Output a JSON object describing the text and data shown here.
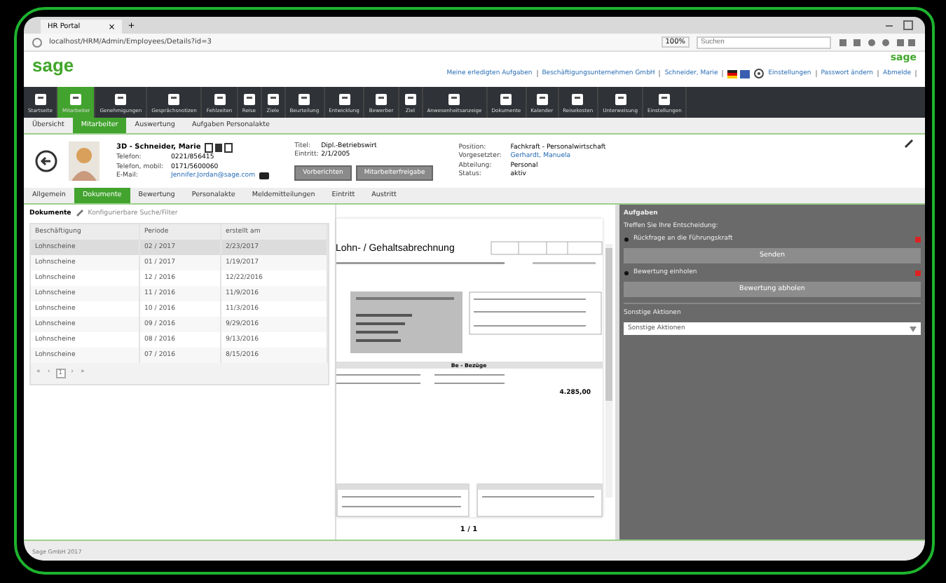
{
  "browser": {
    "tab_title": "HR Portal",
    "tab_close": "×",
    "new_tab": "+",
    "url": "localhost/HRM/Admin/Employees/Details?id=3",
    "zoom": "100%",
    "search_placeholder": "Suchen"
  },
  "header": {
    "logo": "sage",
    "small_logo": "sage",
    "links": [
      "Meine erledigten Aufgaben",
      "Beschäftigungsunternehmen GmbH",
      "Schneider, Marie",
      "Einstellungen",
      "Passwort ändern",
      "Abmelde"
    ]
  },
  "nav": [
    {
      "label": "Startseite",
      "selected": false
    },
    {
      "label": "Mitarbeiter",
      "selected": true
    },
    {
      "label": "Genehmigungen",
      "selected": false
    },
    {
      "label": "Gesprächsnotizen",
      "selected": false
    },
    {
      "label": "Fehlzeiten",
      "selected": false
    },
    {
      "label": "Reise",
      "selected": false
    },
    {
      "label": "Ziele",
      "selected": false
    },
    {
      "label": "Beurteilung",
      "selected": false
    },
    {
      "label": "Entwicklung",
      "selected": false
    },
    {
      "label": "Bewerber",
      "selected": false
    },
    {
      "label": "Ziel",
      "selected": false
    },
    {
      "label": "Anwesenheitsanzeige",
      "selected": false
    },
    {
      "label": "Dokumente",
      "selected": false
    },
    {
      "label": "Kalender",
      "selected": false
    },
    {
      "label": "Reisekosten",
      "selected": false
    },
    {
      "label": "Unterweisung",
      "selected": false
    },
    {
      "label": "Einstellungen",
      "selected": false
    }
  ],
  "subtabs": [
    {
      "label": "Übersicht",
      "selected": false
    },
    {
      "label": "Mitarbeiter",
      "selected": true
    },
    {
      "label": "Auswertung",
      "selected": false
    },
    {
      "label": "Aufgaben Personalakte",
      "selected": false
    }
  ],
  "employee": {
    "name": "3D - Schneider, Marie",
    "left_fields": [
      {
        "label": "Telefon:",
        "value": "0221/856415"
      },
      {
        "label": "Telefon, mobil:",
        "value": "0171/5600060"
      },
      {
        "label": "E-Mail:",
        "value": "Jennifer.Jordan@sage.com",
        "link": true
      }
    ],
    "middle_fields": [
      {
        "label": "Titel:",
        "value": "Dipl.-Betriebswirt"
      },
      {
        "label": "Eintritt:",
        "value": "2/1/2005"
      }
    ],
    "buttons": [
      "Vorberichten",
      "Mitarbeiterfreigabe"
    ],
    "right_fields": [
      {
        "label": "Position:",
        "value": "Fachkraft - Personalwirtschaft",
        "link": false
      },
      {
        "label": "Vorgesetzter:",
        "value": "Gerhardt, Manuela",
        "link": true
      },
      {
        "label": "Abteilung:",
        "value": "Personal",
        "link": false
      },
      {
        "label": "Status:",
        "value": "aktiv",
        "link": false
      }
    ]
  },
  "tabs": [
    {
      "label": "Allgemein",
      "selected": false
    },
    {
      "label": "Dokumente",
      "selected": true
    },
    {
      "label": "Bewertung",
      "selected": false
    },
    {
      "label": "Personalakte",
      "selected": false
    },
    {
      "label": "Meldemitteilungen",
      "selected": false
    },
    {
      "label": "Eintritt",
      "selected": false
    },
    {
      "label": "Austritt",
      "selected": false
    }
  ],
  "documents": {
    "title": "Dokumente",
    "filter": "Konfigurierbare Suche/Filter",
    "columns": [
      "Beschäftigung",
      "Periode",
      "erstellt am"
    ],
    "rows": [
      {
        "cells": [
          "Lohnscheine",
          "02 / 2017",
          "2/23/2017"
        ],
        "selected": true
      },
      {
        "cells": [
          "Lohnscheine",
          "01 / 2017",
          "1/19/2017"
        ],
        "selected": false
      },
      {
        "cells": [
          "Lohnscheine",
          "12 / 2016",
          "12/22/2016"
        ],
        "selected": false
      },
      {
        "cells": [
          "Lohnscheine",
          "11 / 2016",
          "11/9/2016"
        ],
        "selected": false
      },
      {
        "cells": [
          "Lohnscheine",
          "10 / 2016",
          "11/3/2016"
        ],
        "selected": false
      },
      {
        "cells": [
          "Lohnscheine",
          "09 / 2016",
          "9/29/2016"
        ],
        "selected": false
      },
      {
        "cells": [
          "Lohnscheine",
          "08 / 2016",
          "9/13/2016"
        ],
        "selected": false
      },
      {
        "cells": [
          "Lohnscheine",
          "07 / 2016",
          "8/15/2016"
        ],
        "selected": false
      }
    ],
    "pager": [
      {
        "label": "«",
        "selected": false
      },
      {
        "label": "‹",
        "selected": false
      },
      {
        "label": "1",
        "selected": true
      },
      {
        "label": "›",
        "selected": false
      },
      {
        "label": "»",
        "selected": false
      }
    ]
  },
  "preview": {
    "title": "Lohn- / Gehaltsabrechnung",
    "section": "Be - Bezüge",
    "total": "4.285,00",
    "page": "1 / 1"
  },
  "tasks": {
    "title": "Aufgaben",
    "prompt": "Treffen Sie Ihre Entscheidung:",
    "options": [
      {
        "label": "Rückfrage an die Führungskraft",
        "button": "Senden"
      },
      {
        "label": "Bewertung einholen",
        "button": "Bewertung abholen"
      }
    ],
    "other_label": "Sonstige Aktionen",
    "other_select": "Sonstige Aktionen"
  },
  "footer": "Sage GmbH 2017"
}
